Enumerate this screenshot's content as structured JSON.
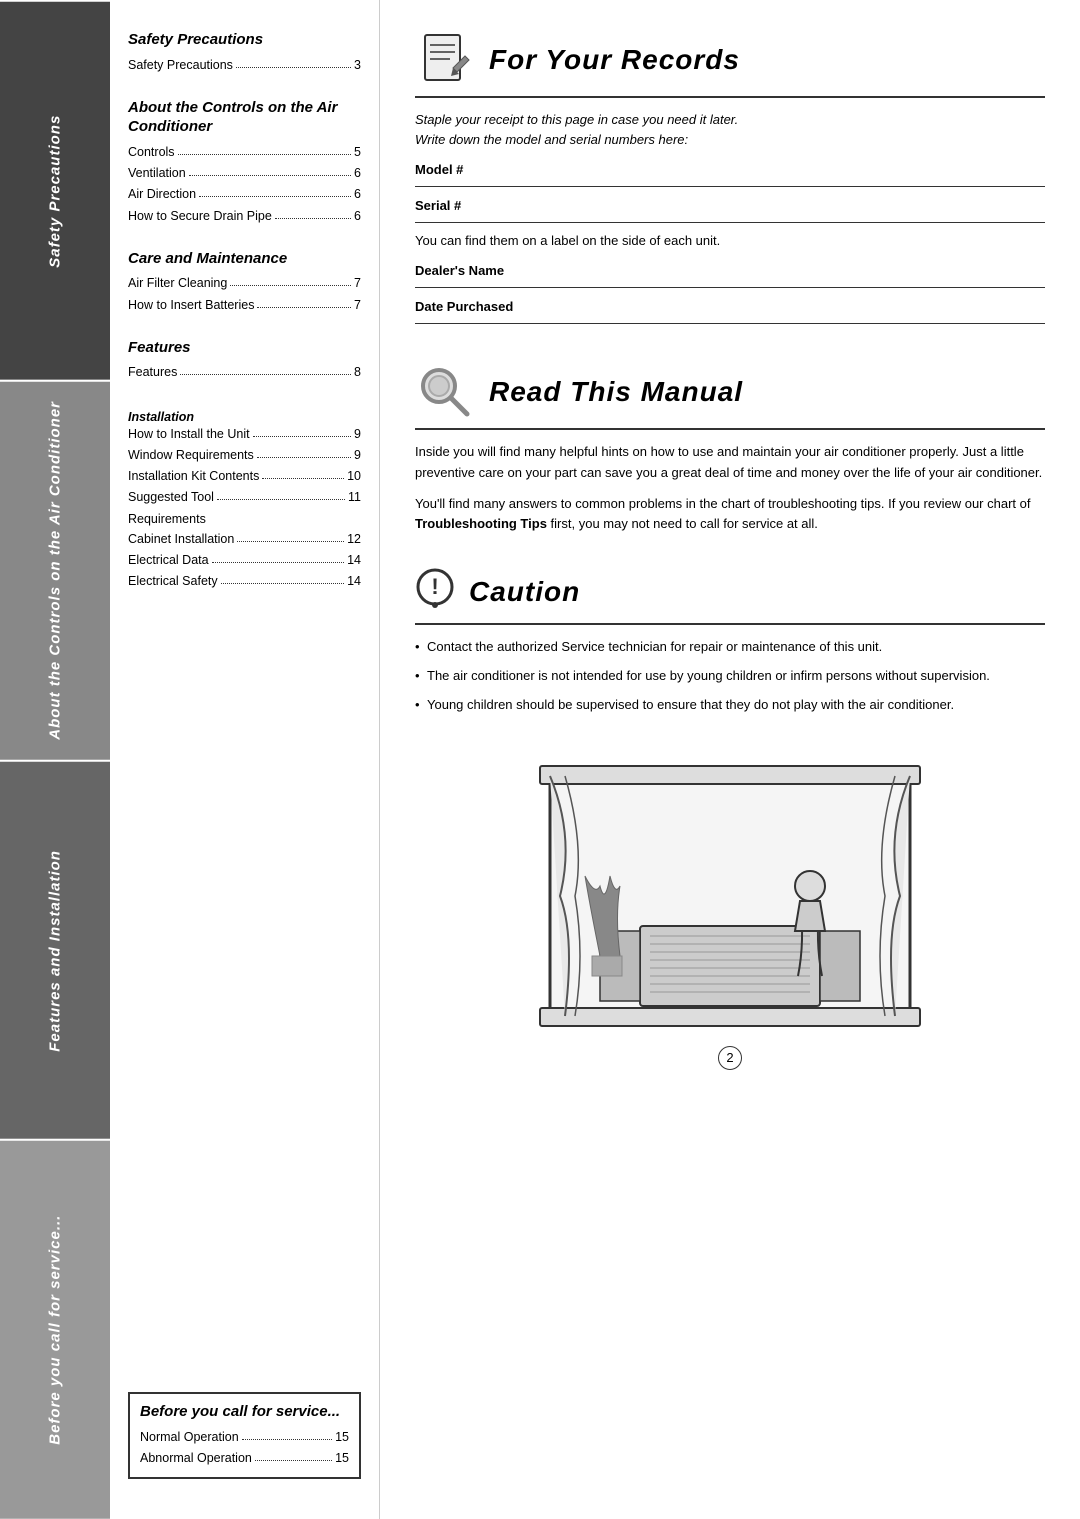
{
  "sidebar": {
    "sections": [
      {
        "label": "Safety Precautions"
      },
      {
        "label": "About the Controls on the Air Conditioner"
      },
      {
        "label": "Features and Installation"
      },
      {
        "label": "Before you call for service..."
      }
    ]
  },
  "toc": {
    "sections": [
      {
        "heading": "Safety Precautions",
        "items": [
          {
            "label": "Safety Precautions",
            "page": "3"
          }
        ]
      },
      {
        "heading": "About the Controls on the Air Conditioner",
        "items": [
          {
            "label": "Controls",
            "page": "5"
          },
          {
            "label": "Ventilation",
            "page": "6"
          },
          {
            "label": "Air Direction",
            "page": "6"
          },
          {
            "label": "How to Secure Drain Pipe",
            "page": "6"
          }
        ]
      },
      {
        "heading": "Care and Maintenance",
        "items": [
          {
            "label": "Air Filter Cleaning",
            "page": "7"
          },
          {
            "label": "How to Insert Batteries",
            "page": "7"
          }
        ]
      },
      {
        "heading": "Features",
        "items": [
          {
            "label": "Features",
            "page": "8"
          }
        ]
      },
      {
        "heading": "Installation",
        "italic": true,
        "items": [
          {
            "label": "How to Install the Unit",
            "page": "9"
          },
          {
            "label": "Window Requirements",
            "page": "9"
          },
          {
            "label": "Installation Kit Contents",
            "page": "10"
          },
          {
            "label": "Suggested Tool Requirements",
            "page": "11"
          },
          {
            "label": "Cabinet Installation",
            "page": "12"
          },
          {
            "label": "Electrical Data",
            "page": "14"
          },
          {
            "label": "Electrical Safety",
            "page": "14"
          }
        ]
      },
      {
        "heading": "Before you call for service...",
        "boxed": true,
        "items": [
          {
            "label": "Normal Operation",
            "page": "15"
          },
          {
            "label": "Abnormal Operation",
            "page": "15"
          }
        ]
      }
    ]
  },
  "main": {
    "for_your_records": {
      "title": "For Your Records",
      "subtitle_line1": "Staple your receipt to this page in case you need it later.",
      "subtitle_line2": "Write down the model and serial numbers here:",
      "model_label": "Model #",
      "serial_label": "Serial #",
      "find_text": "You can find them on a label on the side of each unit.",
      "dealer_label": "Dealer's Name",
      "date_label": "Date Purchased"
    },
    "read_this_manual": {
      "title": "Read This Manual",
      "para1": "Inside you will find many helpful hints on how to use and maintain your air conditioner properly. Just a little preventive care on your part can save you a great deal of time and money over the life of your air conditioner.",
      "para2_start": "You'll find many answers to common problems in the chart of troubleshooting tips. If you review our chart of ",
      "para2_bold": "Troubleshooting Tips",
      "para2_end": " first, you may not need to call for service at all."
    },
    "caution": {
      "title": "Caution",
      "bullets": [
        "Contact the authorized Service technician for repair or maintenance of this unit.",
        "The air conditioner is not intended for use by young children or infirm persons without supervision.",
        "Young children should be supervised to ensure that they do not play with the air conditioner."
      ]
    },
    "page_number": "2"
  }
}
